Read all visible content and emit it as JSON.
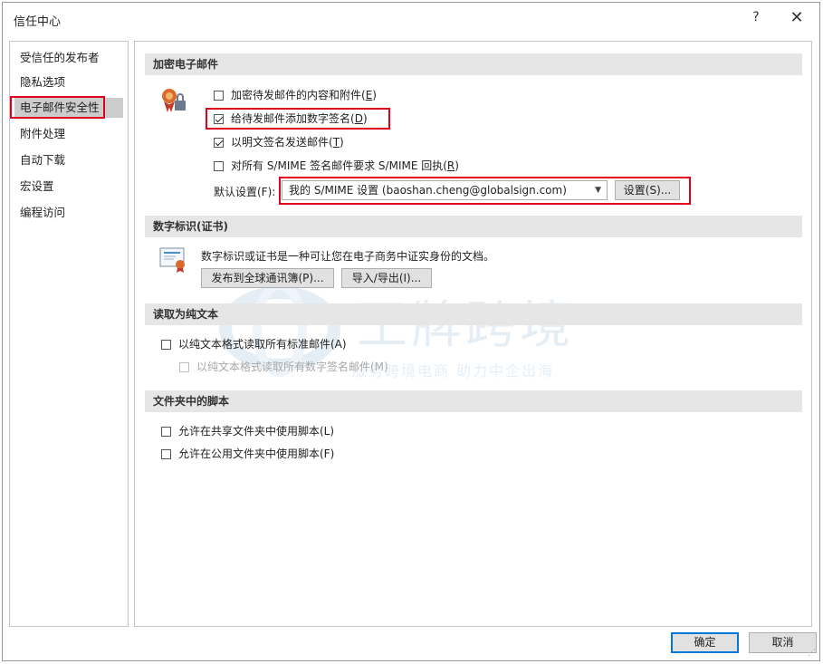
{
  "window": {
    "title": "信任中心",
    "help_glyph": "?",
    "close_glyph": "✕"
  },
  "nav": {
    "items": [
      {
        "label": "受信任的发布者"
      },
      {
        "label": "隐私选项"
      },
      {
        "label": "电子邮件安全性",
        "active": true
      },
      {
        "label": "附件处理"
      },
      {
        "label": "自动下载"
      },
      {
        "label": "宏设置"
      },
      {
        "label": "编程访问"
      }
    ]
  },
  "sections": {
    "encrypt": {
      "header": "加密电子邮件",
      "options": [
        {
          "label": "加密待发邮件的内容和附件(",
          "key": "E",
          "suffix": ")",
          "checked": false
        },
        {
          "label": "给待发邮件添加数字签名(",
          "key": "D",
          "suffix": ")",
          "checked": true
        },
        {
          "label": "以明文签名发送邮件(",
          "key": "T",
          "suffix": ")",
          "checked": true
        },
        {
          "label": "对所有 S/MIME 签名邮件要求 S/MIME 回执(",
          "key": "R",
          "suffix": ")",
          "checked": false
        }
      ],
      "default_label": "默认设置(F):",
      "default_value": "我的 S/MIME 设置 (baoshan.cheng@globalsign.com)",
      "settings_button": "设置(S)..."
    },
    "digital_id": {
      "header": "数字标识(证书)",
      "description": "数字标识或证书是一种可让您在电子商务中证实身份的文档。",
      "publish_button": "发布到全球通讯簿(P)...",
      "import_export_button": "导入/导出(I)..."
    },
    "plain_text": {
      "header": "读取为纯文本",
      "options": [
        {
          "label": "以纯文本格式读取所有标准邮件(A)",
          "checked": false,
          "disabled": false
        },
        {
          "label": "以纯文本格式读取所有数字签名邮件(M)",
          "checked": false,
          "disabled": true
        }
      ]
    },
    "scripts": {
      "header": "文件夹中的脚本",
      "options": [
        {
          "label": "允许在共享文件夹中使用脚本(L)",
          "checked": false
        },
        {
          "label": "允许在公用文件夹中使用脚本(F)",
          "checked": false
        }
      ]
    }
  },
  "watermark": {
    "main": "王牌跨境",
    "tagline": "服务跨境电商 助力中企出海"
  },
  "footer": {
    "ok_label": "确定",
    "cancel_label": "取消"
  },
  "colors": {
    "highlight": "#e0001b",
    "section_bg": "#e6e6e6",
    "nav_active_bg": "#cccccc"
  },
  "icons": [
    "certificate-lock-icon",
    "digital-certificate-icon"
  ]
}
